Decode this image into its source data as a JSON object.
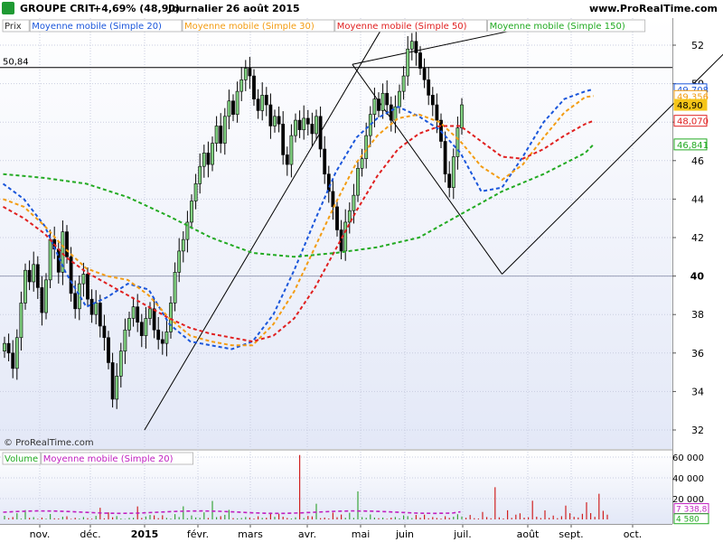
{
  "header": {
    "title": "GROUPE CRIT",
    "change": "+4,69% (48,90)",
    "period": "Journalier",
    "date": "26 août 2015",
    "site": "www.ProRealTime.com"
  },
  "legend_price": [
    {
      "label": "Prix",
      "color": "#333333"
    },
    {
      "label": "Moyenne mobile (Simple 20)",
      "color": "#1a56db"
    },
    {
      "label": "Moyenne mobile (Simple 30)",
      "color": "#f39c12"
    },
    {
      "label": "Moyenne mobile (Simple 50)",
      "color": "#e02020"
    },
    {
      "label": "Moyenne mobile (Simple 150)",
      "color": "#22aa22"
    }
  ],
  "legend_volume": [
    {
      "label": "Volume",
      "color": "#22aa22"
    },
    {
      "label": "Moyenne mobile (Simple 20)",
      "color": "#c020c0"
    }
  ],
  "hline_label": "50,84",
  "copyright": "© ProRealTime.com",
  "chart_data": [
    {
      "type": "candlestick",
      "title": "GROUPE CRIT",
      "ylim": [
        31,
        53
      ],
      "y_ticks": [
        "52",
        "50",
        "48",
        "46",
        "44",
        "42",
        "40",
        "38",
        "36",
        "34",
        "32"
      ],
      "y_tick_values": [
        52,
        50,
        48,
        46,
        44,
        42,
        40,
        38,
        36,
        34,
        32
      ],
      "x_ticks": [
        "nov.",
        "déc.",
        "2015",
        "févr.",
        "mars",
        "avr.",
        "mai",
        "juin",
        "juil.",
        "août",
        "sept.",
        "oct."
      ],
      "horizontal_line": 50.84,
      "price_badges": [
        {
          "label": "49,708",
          "value": 49.708,
          "color": "#1a56db"
        },
        {
          "label": "49,356",
          "value": 49.356,
          "color": "#f39c12"
        },
        {
          "label": "48,90",
          "value": 48.9,
          "color": "#f5c518"
        },
        {
          "label": "48,070",
          "value": 48.07,
          "color": "#e02020"
        },
        {
          "label": "46,841",
          "value": 46.841,
          "color": "#22aa22"
        }
      ],
      "close_series": [
        36.5,
        36.0,
        35.2,
        36.8,
        38.6,
        40.3,
        39.7,
        40.6,
        39.4,
        38.1,
        39.8,
        41.9,
        41.4,
        40.2,
        42.3,
        41.0,
        39.1,
        38.3,
        39.6,
        40.1,
        38.8,
        38.0,
        38.6,
        37.4,
        36.8,
        35.5,
        33.6,
        34.8,
        36.1,
        37.2,
        37.8,
        38.4,
        37.6,
        36.9,
        37.8,
        38.3,
        37.2,
        36.7,
        36.5,
        37.1,
        38.6,
        40.2,
        41.3,
        41.9,
        42.8,
        43.9,
        44.8,
        45.7,
        46.4,
        45.8,
        46.9,
        47.8,
        46.9,
        48.3,
        49.1,
        48.4,
        49.6,
        50.2,
        50.8,
        50.4,
        49.2,
        48.6,
        49.4,
        48.9,
        47.8,
        48.3,
        47.9,
        46.3,
        45.8,
        47.3,
        48.1,
        47.6,
        48.2,
        47.9,
        47.4,
        48.3,
        46.6,
        45.3,
        44.4,
        43.6,
        42.4,
        41.3,
        42.8,
        43.4,
        44.2,
        45.6,
        46.1,
        47.3,
        48.4,
        49.2,
        48.6,
        49.5,
        48.9,
        48.1,
        48.8,
        49.6,
        50.4,
        51.8,
        52.2,
        51.6,
        50.8,
        50.2,
        49.4,
        48.9,
        48.1,
        47.0,
        45.3,
        44.6,
        46.2,
        47.7,
        48.9
      ],
      "moving_averages": [
        {
          "name": "Moyenne mobile (Simple 20)",
          "color": "#1a56db",
          "points": [
            [
              0,
              44.8
            ],
            [
              5,
              44.0
            ],
            [
              10,
              42.6
            ],
            [
              15,
              40.2
            ],
            [
              20,
              38.4
            ],
            [
              25,
              38.9
            ],
            [
              30,
              39.6
            ],
            [
              35,
              39.3
            ],
            [
              40,
              37.5
            ],
            [
              45,
              36.6
            ],
            [
              50,
              36.4
            ],
            [
              55,
              36.2
            ],
            [
              60,
              36.6
            ],
            [
              65,
              38.0
            ],
            [
              70,
              40.3
            ],
            [
              75,
              42.9
            ],
            [
              80,
              45.4
            ],
            [
              85,
              47.2
            ],
            [
              90,
              48.2
            ],
            [
              95,
              48.8
            ],
            [
              100,
              48.3
            ],
            [
              105,
              47.6
            ],
            [
              110,
              46.4
            ],
            [
              115,
              44.4
            ],
            [
              120,
              44.6
            ],
            [
              125,
              46.2
            ],
            [
              130,
              48.0
            ],
            [
              135,
              49.2
            ],
            [
              140,
              49.6
            ],
            [
              142,
              49.708
            ]
          ]
        },
        {
          "name": "Moyenne mobile (Simple 30)",
          "color": "#f39c12",
          "points": [
            [
              0,
              44.0
            ],
            [
              5,
              43.6
            ],
            [
              10,
              42.6
            ],
            [
              15,
              41.4
            ],
            [
              20,
              40.4
            ],
            [
              25,
              40.0
            ],
            [
              30,
              39.8
            ],
            [
              35,
              39.0
            ],
            [
              40,
              37.8
            ],
            [
              45,
              36.9
            ],
            [
              50,
              36.6
            ],
            [
              55,
              36.4
            ],
            [
              60,
              36.4
            ],
            [
              65,
              37.5
            ],
            [
              70,
              39.2
            ],
            [
              75,
              41.5
            ],
            [
              80,
              43.8
            ],
            [
              85,
              45.9
            ],
            [
              90,
              47.3
            ],
            [
              95,
              48.2
            ],
            [
              100,
              48.4
            ],
            [
              105,
              48.0
            ],
            [
              110,
              47.0
            ],
            [
              115,
              45.7
            ],
            [
              120,
              45.0
            ],
            [
              125,
              45.8
            ],
            [
              130,
              47.2
            ],
            [
              135,
              48.5
            ],
            [
              140,
              49.3
            ],
            [
              142,
              49.356
            ]
          ]
        },
        {
          "name": "Moyenne mobile (Simple 50)",
          "color": "#e02020",
          "points": [
            [
              0,
              43.6
            ],
            [
              5,
              43.0
            ],
            [
              10,
              42.2
            ],
            [
              15,
              41.0
            ],
            [
              20,
              40.2
            ],
            [
              25,
              39.6
            ],
            [
              30,
              39.0
            ],
            [
              35,
              38.4
            ],
            [
              40,
              37.8
            ],
            [
              45,
              37.3
            ],
            [
              50,
              37.0
            ],
            [
              55,
              36.8
            ],
            [
              60,
              36.6
            ],
            [
              65,
              36.9
            ],
            [
              70,
              37.8
            ],
            [
              75,
              39.4
            ],
            [
              80,
              41.4
            ],
            [
              85,
              43.4
            ],
            [
              90,
              45.2
            ],
            [
              95,
              46.6
            ],
            [
              100,
              47.4
            ],
            [
              105,
              47.8
            ],
            [
              110,
              47.8
            ],
            [
              115,
              47.0
            ],
            [
              120,
              46.2
            ],
            [
              125,
              46.1
            ],
            [
              130,
              46.6
            ],
            [
              135,
              47.3
            ],
            [
              140,
              47.9
            ],
            [
              142,
              48.07
            ]
          ]
        },
        {
          "name": "Moyenne mobile (Simple 150)",
          "color": "#22aa22",
          "points": [
            [
              0,
              45.3
            ],
            [
              10,
              45.1
            ],
            [
              20,
              44.8
            ],
            [
              30,
              44.1
            ],
            [
              40,
              43.1
            ],
            [
              50,
              42.0
            ],
            [
              60,
              41.2
            ],
            [
              70,
              41.0
            ],
            [
              80,
              41.2
            ],
            [
              90,
              41.5
            ],
            [
              100,
              42.0
            ],
            [
              110,
              43.2
            ],
            [
              120,
              44.4
            ],
            [
              130,
              45.3
            ],
            [
              140,
              46.4
            ],
            [
              142,
              46.841
            ]
          ]
        }
      ],
      "trendlines": [
        {
          "from": [
            34,
            32.0
          ],
          "to": [
            92,
            53.2
          ]
        },
        {
          "from": [
            84,
            51.0
          ],
          "to": [
            120,
            40.1
          ]
        },
        {
          "from": [
            120,
            40.1
          ],
          "to": [
            181,
            53.2
          ]
        },
        {
          "from": [
            84,
            51.0
          ],
          "to": [
            132,
            53.2
          ]
        }
      ]
    },
    {
      "type": "bar",
      "title": "Volume",
      "ylim": [
        0,
        65000
      ],
      "y_ticks": [
        "60 000",
        "40 000",
        "20 000"
      ],
      "y_tick_values": [
        60000,
        40000,
        20000
      ],
      "badges": [
        {
          "label": "7 338,8",
          "value": 7338.8,
          "color": "#c020c0"
        },
        {
          "label": "4 580",
          "value": 4580,
          "color": "#22aa22"
        }
      ],
      "values": [
        3500,
        1200,
        2300,
        6000,
        800,
        9000,
        1500,
        2200,
        600,
        1800,
        700,
        5200,
        1100,
        900,
        2600,
        3000,
        500,
        1600,
        800,
        2300,
        1200,
        700,
        3400,
        11200,
        1000,
        6800,
        2100,
        3200,
        900,
        400,
        1500,
        1600,
        12500,
        1400,
        2800,
        4300,
        3900,
        1200,
        4000,
        1500,
        800,
        5100,
        2300,
        12600,
        1100,
        3800,
        1900,
        1600,
        6800,
        1400,
        17800,
        2200,
        3100,
        4400,
        9200,
        1300,
        1000,
        1400,
        2300,
        1700,
        800,
        3000,
        1500,
        1600,
        6600,
        2500,
        5400,
        2600,
        1400,
        900,
        2000,
        62000,
        1300,
        3300,
        2900,
        15100,
        1200,
        1800,
        900,
        6600,
        2100,
        4700,
        1600,
        6400,
        1500,
        27000,
        2200,
        1600,
        4800,
        1800,
        1200,
        1800,
        600,
        1700,
        2300,
        1000,
        3900,
        3100,
        1300,
        4300,
        1600,
        4600,
        1100,
        2300,
        1400,
        800,
        3100,
        1500,
        2600,
        5000,
        2800,
        1600,
        4300,
        1200,
        900,
        7200,
        2300,
        1100,
        31000,
        2000,
        900,
        8800,
        1500,
        4600,
        5900,
        1700,
        2100,
        18000,
        2600,
        1300,
        8700,
        1500,
        3700,
        1200,
        3100,
        13300,
        6000,
        2500,
        1900,
        5400,
        16500,
        6100,
        2500,
        24700,
        8300,
        4580
      ],
      "moving_average": {
        "name": "Moyenne mobile (Simple 20)",
        "color": "#c020c0",
        "value": 7338.8
      }
    }
  ]
}
